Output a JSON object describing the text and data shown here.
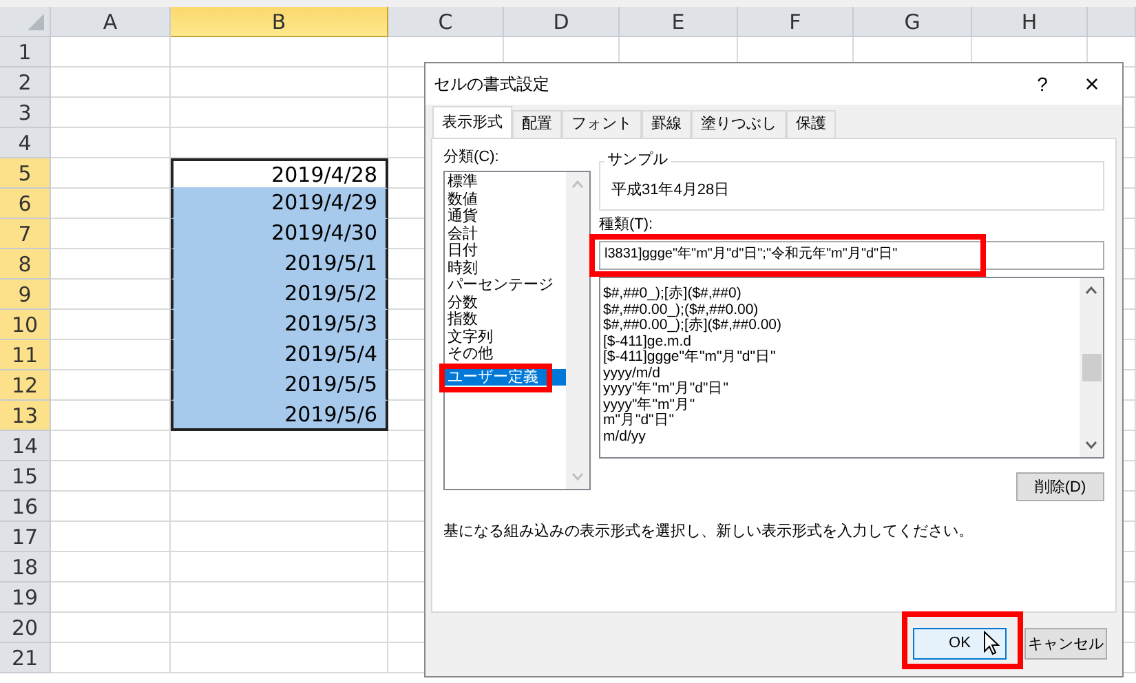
{
  "sheet": {
    "columns": [
      {
        "label": "A",
        "selected": false
      },
      {
        "label": "B",
        "selected": true
      },
      {
        "label": "C",
        "selected": false
      },
      {
        "label": "D",
        "selected": false
      },
      {
        "label": "E",
        "selected": false
      },
      {
        "label": "F",
        "selected": false
      },
      {
        "label": "G",
        "selected": false
      },
      {
        "label": "H",
        "selected": false
      }
    ],
    "rows": [
      {
        "number": "1",
        "selected": false,
        "cell_b": "",
        "active": false
      },
      {
        "number": "2",
        "selected": false,
        "cell_b": "",
        "active": false
      },
      {
        "number": "3",
        "selected": false,
        "cell_b": "",
        "active": false
      },
      {
        "number": "4",
        "selected": false,
        "cell_b": "",
        "active": false
      },
      {
        "number": "5",
        "selected": true,
        "cell_b": "2019/4/28",
        "active": true
      },
      {
        "number": "6",
        "selected": true,
        "cell_b": "2019/4/29",
        "active": false
      },
      {
        "number": "7",
        "selected": true,
        "cell_b": "2019/4/30",
        "active": false
      },
      {
        "number": "8",
        "selected": true,
        "cell_b": "2019/5/1",
        "active": false
      },
      {
        "number": "9",
        "selected": true,
        "cell_b": "2019/5/2",
        "active": false
      },
      {
        "number": "10",
        "selected": true,
        "cell_b": "2019/5/3",
        "active": false
      },
      {
        "number": "11",
        "selected": true,
        "cell_b": "2019/5/4",
        "active": false
      },
      {
        "number": "12",
        "selected": true,
        "cell_b": "2019/5/5",
        "active": false
      },
      {
        "number": "13",
        "selected": true,
        "cell_b": "2019/5/6",
        "active": false
      },
      {
        "number": "14",
        "selected": false,
        "cell_b": "",
        "active": false
      },
      {
        "number": "15",
        "selected": false,
        "cell_b": "",
        "active": false
      },
      {
        "number": "16",
        "selected": false,
        "cell_b": "",
        "active": false
      },
      {
        "number": "17",
        "selected": false,
        "cell_b": "",
        "active": false
      },
      {
        "number": "18",
        "selected": false,
        "cell_b": "",
        "active": false
      },
      {
        "number": "19",
        "selected": false,
        "cell_b": "",
        "active": false
      },
      {
        "number": "20",
        "selected": false,
        "cell_b": "",
        "active": false
      },
      {
        "number": "21",
        "selected": false,
        "cell_b": "",
        "active": false
      }
    ]
  },
  "dialog": {
    "title": "セルの書式設定",
    "help": "?",
    "close": "×",
    "tabs": [
      {
        "label": "表示形式",
        "selected": true
      },
      {
        "label": "配置",
        "selected": false
      },
      {
        "label": "フォント",
        "selected": false
      },
      {
        "label": "罫線",
        "selected": false
      },
      {
        "label": "塗りつぶし",
        "selected": false
      },
      {
        "label": "保護",
        "selected": false
      }
    ],
    "category_label": "分類(C):",
    "categories": [
      {
        "label": "標準",
        "selected": false
      },
      {
        "label": "数値",
        "selected": false
      },
      {
        "label": "通貨",
        "selected": false
      },
      {
        "label": "会計",
        "selected": false
      },
      {
        "label": "日付",
        "selected": false
      },
      {
        "label": "時刻",
        "selected": false
      },
      {
        "label": "パーセンテージ",
        "selected": false
      },
      {
        "label": "分数",
        "selected": false
      },
      {
        "label": "指数",
        "selected": false
      },
      {
        "label": "文字列",
        "selected": false
      },
      {
        "label": "その他",
        "selected": false
      },
      {
        "label": "ユーザー定義",
        "selected": true
      }
    ],
    "sample_label": "サンプル",
    "sample_value": "平成31年4月28日",
    "type_label": "種類(T):",
    "type_value": "l3831]ggge\"年\"m\"月\"d\"日\";\"令和元年\"m\"月\"d\"日\"",
    "formats": [
      "$#,##0_);[赤]($#,##0)",
      "$#,##0.00_);($#,##0.00)",
      "$#,##0.00_);[赤]($#,##0.00)",
      "[$-411]ge.m.d",
      "[$-411]ggge\"年\"m\"月\"d\"日\"",
      "yyyy/m/d",
      "yyyy\"年\"m\"月\"d\"日\"",
      "yyyy\"年\"m\"月\"",
      "m\"月\"d\"日\"",
      "m/d/yy"
    ],
    "delete_button": "削除(D)",
    "description": "基になる組み込みの表示形式を選択し、新しい表示形式を入力してください。",
    "ok_button": "OK",
    "cancel_button": "キャンセル"
  }
}
